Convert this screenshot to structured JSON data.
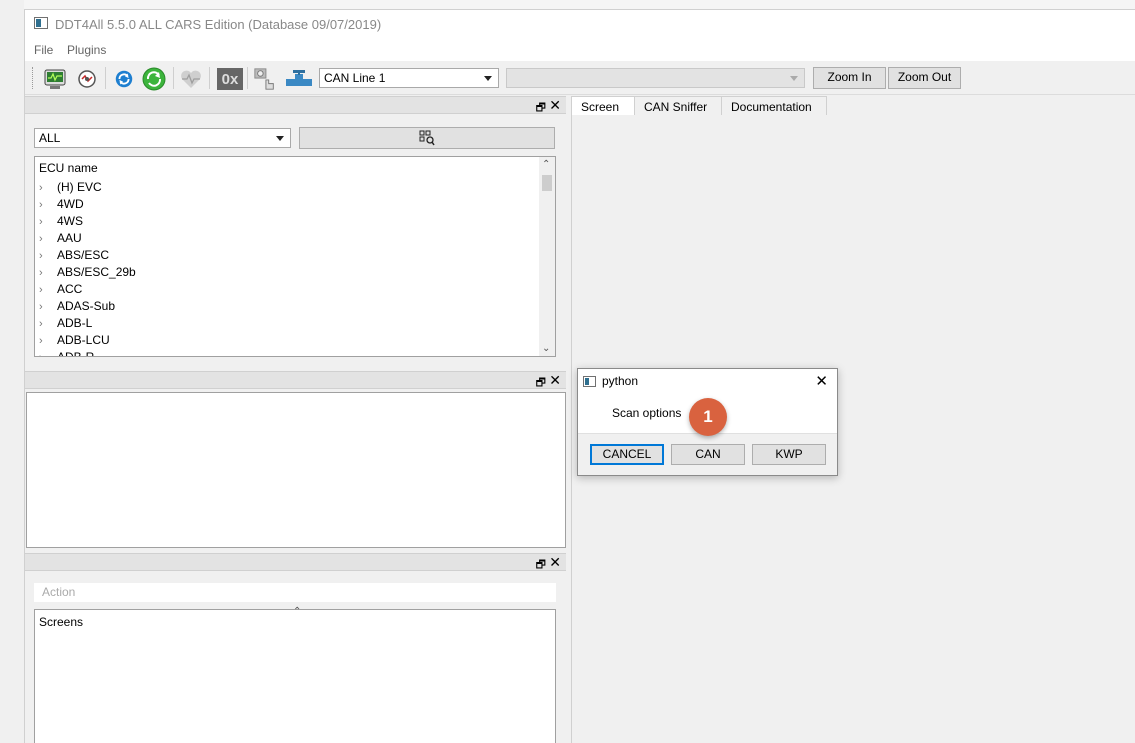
{
  "window": {
    "title": "DDT4All 5.5.0 ALL CARS Edition (Database 09/07/2019)"
  },
  "menu": {
    "file": "File",
    "plugins": "Plugins"
  },
  "toolbar": {
    "can_line": "CAN Line 1",
    "second_combo": "",
    "zoom_in": "Zoom In",
    "zoom_out": "Zoom Out",
    "hex_label": "0x",
    "icons": [
      "ecu-scan-icon",
      "sniffer-icon",
      "refresh-icon",
      "connect-icon",
      "health-icon",
      "hex-icon",
      "settings-hand-icon",
      "valve-icon"
    ]
  },
  "ecu_panel": {
    "filter": "ALL",
    "header": "ECU name",
    "items": [
      "(H) EVC",
      "4WD",
      "4WS",
      "AAU",
      "ABS/ESC",
      "ABS/ESC_29b",
      "ACC",
      "ADAS-Sub",
      "ADB-L",
      "ADB-LCU",
      "ADB-R"
    ]
  },
  "action_panel": {
    "action_label": "Action",
    "screens_label": "Screens"
  },
  "tabs": [
    "Screen",
    "CAN Sniffer",
    "Documentation"
  ],
  "dialog": {
    "title": "python",
    "message": "Scan options",
    "buttons": {
      "cancel": "CANCEL",
      "can": "CAN",
      "kwp": "KWP"
    }
  },
  "annotation": {
    "marker": "1",
    "marker_color": "#d9623f"
  },
  "colors": {
    "accent": "#0078d7",
    "connect_green": "#3cb43c",
    "refresh_blue": "#1e7fd0"
  }
}
